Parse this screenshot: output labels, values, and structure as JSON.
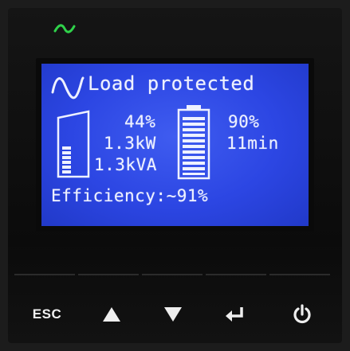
{
  "indicator": {
    "name": "status-led-icon",
    "color": "#2fd24a"
  },
  "lcd": {
    "background_color": "#2c46e3",
    "status_icon": "sine-wave-icon",
    "status_text": "Load protected",
    "load": {
      "percent": "44%",
      "power": "1.3kW",
      "apparent_power": "1.3kVA",
      "icon": "load-level-icon",
      "level_fraction": 0.44
    },
    "battery": {
      "charge": "90%",
      "runtime": "11min",
      "icon": "battery-level-icon",
      "level_fraction": 0.9
    },
    "efficiency": "Efficiency:~91%"
  },
  "buttons": {
    "esc_label": "ESC",
    "up_icon": "up-arrow-icon",
    "down_icon": "down-arrow-icon",
    "enter_icon": "enter-icon",
    "power_icon": "power-icon"
  }
}
